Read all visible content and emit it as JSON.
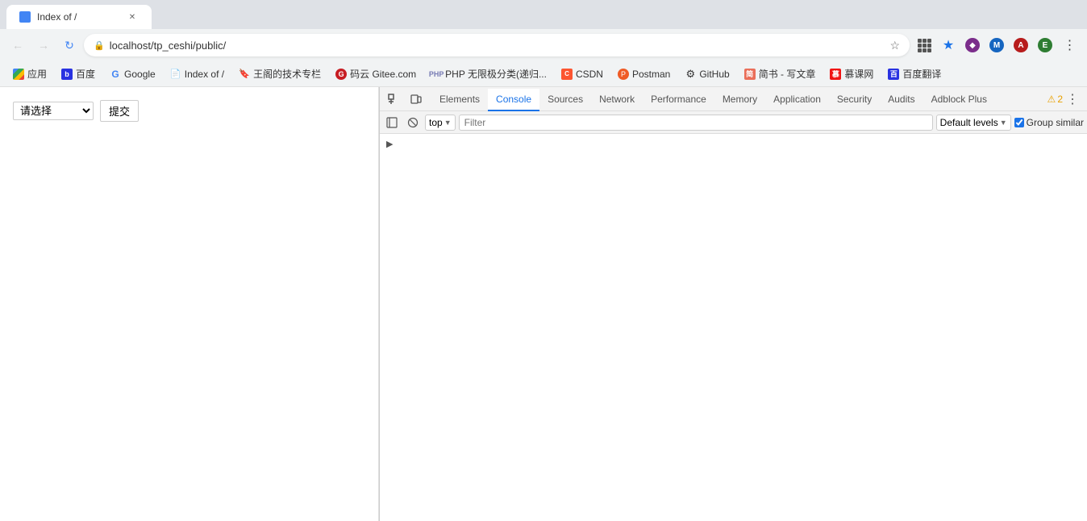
{
  "browser": {
    "tab": {
      "title": "Index of /",
      "favicon_color": "#4285f4"
    },
    "address_bar": {
      "url": "localhost/tp_ceshi/public/",
      "protocol_icon": "🔒"
    },
    "bookmarks": [
      {
        "id": "apps",
        "label": "应用",
        "icon": "grid"
      },
      {
        "id": "baidu",
        "label": "百度",
        "icon": "b"
      },
      {
        "id": "google",
        "label": "Google",
        "icon": "G"
      },
      {
        "id": "index-of",
        "label": "Index of /",
        "icon": "doc"
      },
      {
        "id": "wang-tech",
        "label": "王阁的技术专栏",
        "icon": "bookmark"
      },
      {
        "id": "gitee",
        "label": "码云 Gitee.com",
        "icon": "g"
      },
      {
        "id": "php-class",
        "label": "PHP 无限极分类(递归...",
        "icon": "php"
      },
      {
        "id": "csdn",
        "label": "CSDN",
        "icon": "C"
      },
      {
        "id": "postman",
        "label": "Postman",
        "icon": "pm"
      },
      {
        "id": "github",
        "label": "GitHub",
        "icon": "gh"
      },
      {
        "id": "jianshu",
        "label": "简书 - 写文章",
        "icon": "J"
      },
      {
        "id": "mooc",
        "label": "慕课网",
        "icon": "M"
      },
      {
        "id": "baidu-translate",
        "label": "百度翻译",
        "icon": "T"
      }
    ]
  },
  "page": {
    "title": "Index of /",
    "form": {
      "select_placeholder": "请选择",
      "submit_label": "提交"
    }
  },
  "devtools": {
    "tabs": [
      {
        "id": "elements",
        "label": "Elements",
        "active": false
      },
      {
        "id": "console",
        "label": "Console",
        "active": true
      },
      {
        "id": "sources",
        "label": "Sources",
        "active": false
      },
      {
        "id": "network",
        "label": "Network",
        "active": false
      },
      {
        "id": "performance",
        "label": "Performance",
        "active": false
      },
      {
        "id": "memory",
        "label": "Memory",
        "active": false
      },
      {
        "id": "application",
        "label": "Application",
        "active": false
      },
      {
        "id": "security",
        "label": "Security",
        "active": false
      },
      {
        "id": "audits",
        "label": "Audits",
        "active": false
      },
      {
        "id": "adblock-plus",
        "label": "Adblock Plus",
        "active": false
      }
    ],
    "warning_count": "2",
    "console": {
      "context": "top",
      "filter_placeholder": "Filter",
      "levels_label": "Default levels",
      "group_similar_label": "Group similar",
      "group_similar_checked": true
    }
  },
  "nav_extensions": [
    {
      "id": "ext1",
      "color": "#1a73e8",
      "label": "★"
    },
    {
      "id": "ext2",
      "color": "#7b2d8b",
      "label": "◆"
    },
    {
      "id": "ext3",
      "color": "#1565c0",
      "label": "M"
    },
    {
      "id": "ext4",
      "color": "#b71c1c",
      "label": "A"
    },
    {
      "id": "ext5",
      "color": "#2e7d32",
      "label": "E"
    }
  ]
}
